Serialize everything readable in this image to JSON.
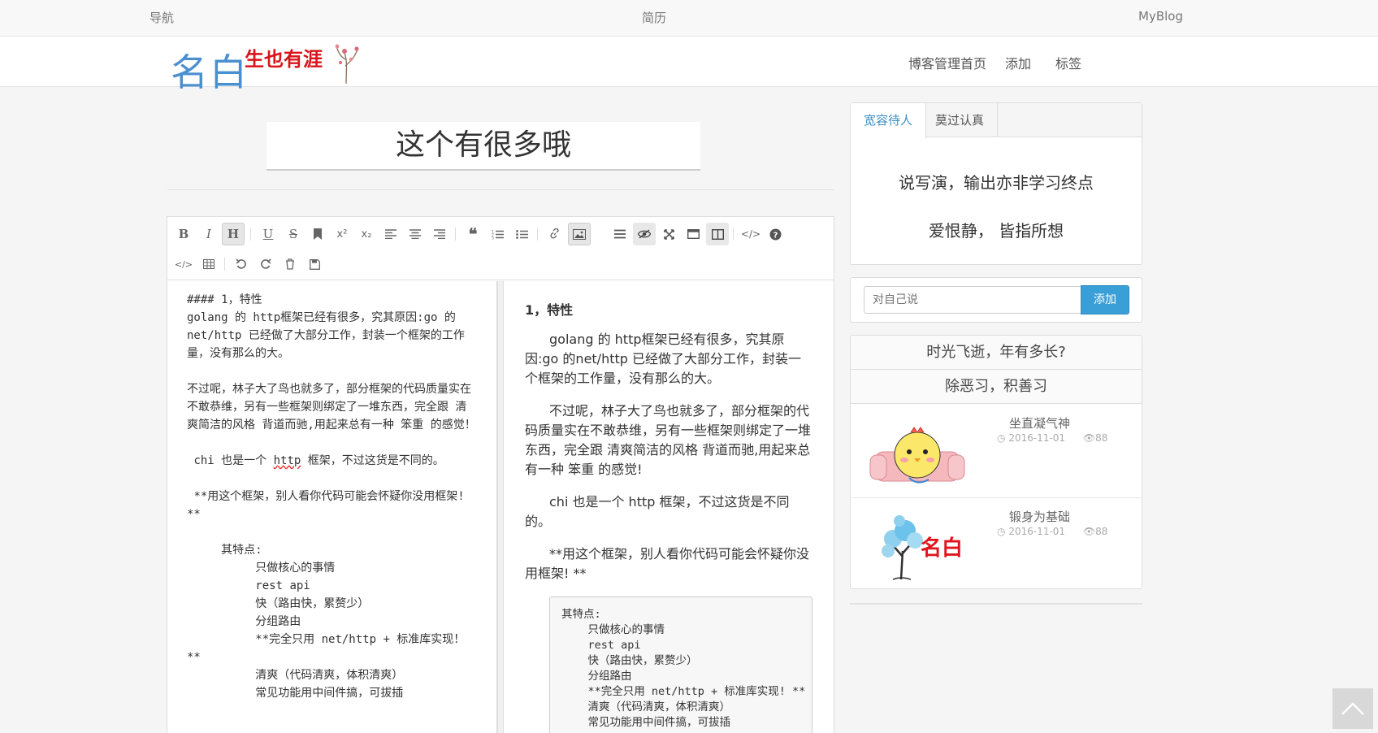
{
  "topnav": {
    "left": "导航",
    "center": "简历",
    "right": "MyBlog"
  },
  "header": {
    "logo_main": "名白",
    "logo_sub": "生也有涯",
    "nav": [
      "博客管理首页",
      "添加",
      "标签"
    ]
  },
  "post": {
    "title": "这个有很多哦"
  },
  "editor": {
    "toolbar_row1": [
      "bold-icon",
      "italic-icon",
      "heading-icon",
      "underline-icon",
      "strikethrough-icon",
      "bookmark-icon",
      "superscript-icon",
      "subscript-icon",
      "align-left-icon",
      "align-center-icon",
      "align-right-icon",
      "quote-icon",
      "ordered-list-icon",
      "unordered-list-icon",
      "link-icon",
      "image-icon",
      "menu-icon",
      "eye-icon",
      "fullscreen-icon",
      "window-icon",
      "columns-icon",
      "code-icon",
      "help-icon"
    ],
    "toolbar_row2": [
      "code-block-icon",
      "table-icon",
      "undo-icon",
      "redo-icon",
      "trash-icon",
      "save-icon"
    ],
    "source": {
      "l1": "#### 1，特性",
      "l2": "golang 的 http框架已经有很多，究其原因:go 的net/http 已经做了大部分工作，封装一个框架的工作量，没有那么的大。",
      "l3": "不过呢，林子大了鸟也就多了，部分框架的代码质量实在不敢恭维，另有一些框架则绑定了一堆东西，完全跟 清爽简洁的风格 背道而驰,用起来总有一种 笨重 的感觉！",
      "l4a": " chi 也是一个 ",
      "l4b": "http",
      "l4c": " 框架，不过这货是不同的。",
      "l5": " **用这个框架，别人看你代码可能会怀疑你没用框架! **",
      "l6": "     其特点:\n          只做核心的事情\n          rest api\n          快（路由快，累赘少）\n          分组路由\n          **完全只用 net/http + 标准库实现！\n**\n          清爽（代码清爽，体积清爽）\n          常见功能用中间件搞，可拔插"
    },
    "preview": {
      "h": "1，特性",
      "p1": "golang 的 http框架已经有很多，究其原因:go 的net/http 已经做了大部分工作，封装一个框架的工作量，没有那么的大。",
      "p2": "不过呢，林子大了鸟也就多了，部分框架的代码质量实在不敢恭维，另有一些框架则绑定了一堆东西，完全跟 清爽简洁的风格 背道而驰,用起来总有一种 笨重 的感觉!",
      "p3": "chi 也是一个 http 框架，不过这货是不同的。",
      "p4": "**用这个框架，别人看你代码可能会怀疑你没用框架! **",
      "pre": "其特点:\n    只做核心的事情\n    rest api\n    快（路由快，累赘少）\n    分组路由\n    **完全只用 net/http + 标准库实现! **\n    清爽（代码清爽，体积清爽）\n    常见功能用中间件搞，可拔插"
    }
  },
  "sidebar": {
    "tabs": [
      "宽容待人",
      "莫过认真"
    ],
    "mottos": [
      "说写演，输出亦非学习终点",
      "爱恨静， 皆指所想"
    ],
    "say": {
      "placeholder": "对自己说",
      "button": "添加"
    },
    "headings": [
      "时光飞逝，年有多长?",
      "除恶习，积善习"
    ],
    "posts": [
      {
        "title": "坐直凝气神",
        "date": "2016-11-01",
        "views": "88"
      },
      {
        "title": "锻身为基础",
        "date": "2016-11-01",
        "views": "88"
      }
    ],
    "thumb2_text": "名白"
  },
  "colors": {
    "accent": "#3a9fd6",
    "logo_blue": "#4a8fcf",
    "logo_red": "#d9141b"
  }
}
